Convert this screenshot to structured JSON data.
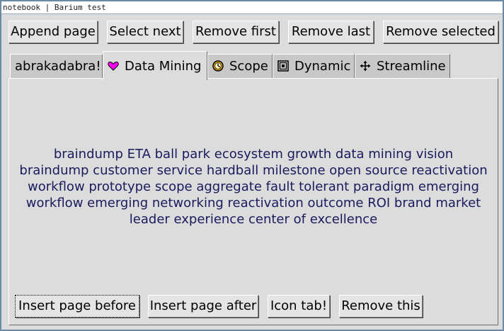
{
  "window": {
    "title": "notebook | Barium test"
  },
  "toolbar": {
    "append_page": "Append page",
    "select_next": "Select next",
    "remove_first": "Remove first",
    "remove_last": "Remove last",
    "remove_selected": "Remove selected"
  },
  "tabs": [
    {
      "label": "abrakadabra!",
      "icon": null
    },
    {
      "label": "Data Mining",
      "icon": "heart-icon"
    },
    {
      "label": "Scope",
      "icon": "clock-icon"
    },
    {
      "label": "Dynamic",
      "icon": "spiral-square-icon"
    },
    {
      "label": "Streamline",
      "icon": "move-arrows-icon"
    }
  ],
  "active_tab": "Data Mining",
  "page": {
    "text": "braindump ETA ball park ecosystem growth data mining vision braindump customer service hardball milestone open source reactivation workflow prototype scope aggregate fault tolerant paradigm emerging workflow emerging networking reactivation outcome ROI brand market leader experience center of excellence",
    "buttons": {
      "insert_before": "Insert page before",
      "insert_after": "Insert page after",
      "icon_tab": "Icon tab!",
      "remove_this": "Remove this"
    }
  },
  "colors": {
    "text_accent": "#1a1a5e",
    "heart": "#ff00ff",
    "clock": "#f0b400"
  }
}
